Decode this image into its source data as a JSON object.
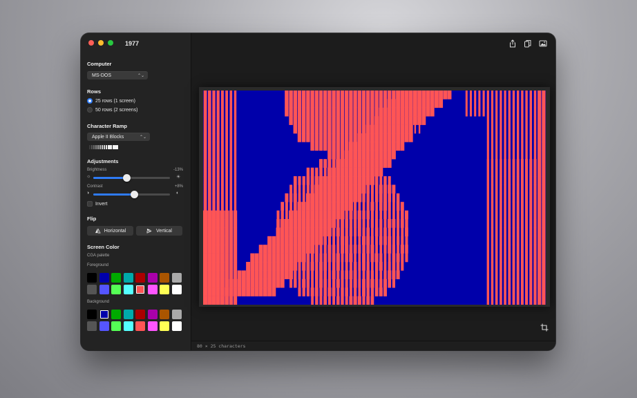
{
  "window": {
    "title": "1977"
  },
  "toolbar": {
    "icons": [
      "share-icon",
      "copy-icon",
      "image-export-icon"
    ]
  },
  "sidebar": {
    "computer": {
      "heading": "Computer",
      "selected": "MS-DOS"
    },
    "rows": {
      "heading": "Rows",
      "options": [
        {
          "label": "25 rows (1 screen)",
          "selected": true
        },
        {
          "label": "50 rows (2 screens)",
          "selected": false
        }
      ]
    },
    "ramp": {
      "heading": "Character Ramp",
      "selected": "Apple II Blocks"
    },
    "adjustments": {
      "heading": "Adjustments",
      "brightness": {
        "label": "Brightness",
        "value": "-13%",
        "level": 0.44
      },
      "contrast": {
        "label": "Contrast",
        "value": "+8%",
        "level": 0.54
      },
      "invert_label": "Invert"
    },
    "flip": {
      "heading": "Flip",
      "horizontal": "Horizontal",
      "vertical": "Vertical"
    },
    "screen_color": {
      "heading": "Screen Color",
      "palette_name": "CGA palette",
      "foreground_label": "Foreground",
      "background_label": "Background",
      "colors": [
        "#000000",
        "#0000AA",
        "#00AA00",
        "#00AAAA",
        "#AA0000",
        "#AA00AA",
        "#AA5500",
        "#AAAAAA",
        "#555555",
        "#5555FF",
        "#55FF55",
        "#55FFFF",
        "#FF5555",
        "#FF55FF",
        "#FFFF55",
        "#FFFFFF"
      ],
      "foreground_selected": 12,
      "background_selected": 1
    }
  },
  "canvas": {
    "foreground": "#FF5555",
    "background": "#0000AA"
  },
  "status": {
    "text": "80 × 25 characters"
  }
}
